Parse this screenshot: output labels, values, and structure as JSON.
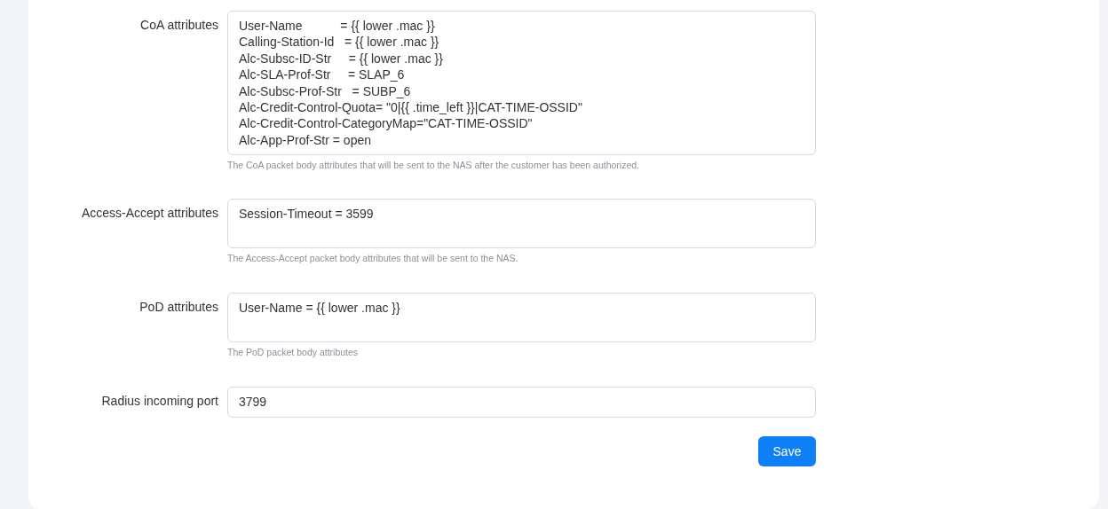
{
  "fields": [
    {
      "kind": "textarea",
      "label": "CoA attributes",
      "lines": [
        "User-Name           = {{ lower .mac }}",
        "Calling-Station-Id   = {{ lower .mac }}",
        "Alc-Subsc-ID-Str     = {{ lower .mac }}",
        "Alc-SLA-Prof-Str     = SLAP_6",
        "Alc-Subsc-Prof-Str   = SUBP_6",
        "Alc-Credit-Control-Quota= \"0|{{ .time_left }}|CAT-TIME-OSSID\"",
        "Alc-Credit-Control-CategoryMap=\"CAT-TIME-OSSID\"",
        "Alc-App-Prof-Str = open"
      ],
      "help": "The CoA packet body attributes that will be sent to the NAS after the customer has been authorized."
    },
    {
      "kind": "textarea",
      "label": "Access-Accept attributes",
      "lines": [
        "Session-Timeout = 3599"
      ],
      "help": "The Access-Accept packet body attributes that will be sent to the NAS."
    },
    {
      "kind": "textarea",
      "label": "PoD attributes",
      "lines": [
        "User-Name = {{ lower .mac }}"
      ],
      "help": "The PoD packet body attributes"
    },
    {
      "kind": "input",
      "label": "Radius incoming port",
      "lines": [
        "3799"
      ]
    }
  ],
  "save_button": "Save"
}
